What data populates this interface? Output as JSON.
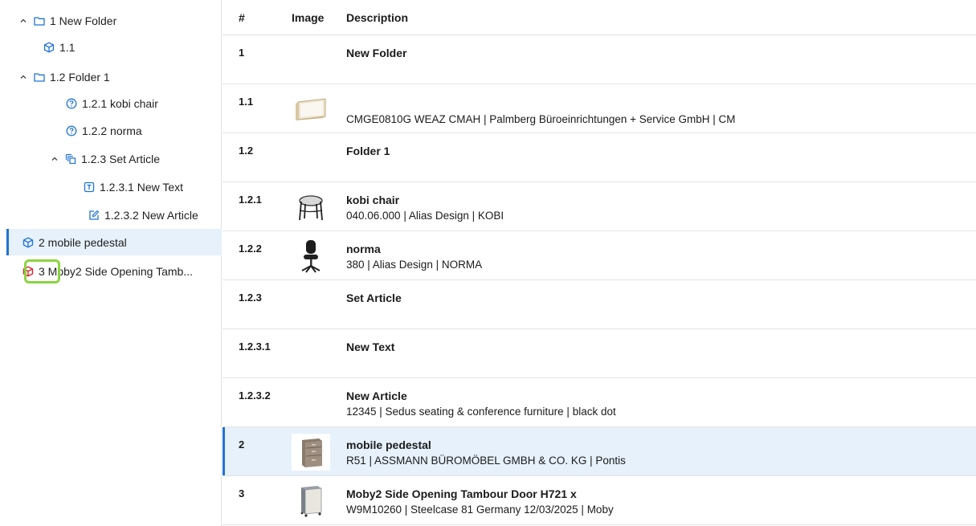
{
  "tree": {
    "items": [
      {
        "label": "1 New Folder",
        "icon": "folder-icon",
        "chevron": true,
        "indent": 0
      },
      {
        "label": "1.1",
        "icon": "box-icon",
        "chevron": false,
        "indent": 1
      },
      {
        "label": "1.2 Folder 1",
        "icon": "folder-icon",
        "chevron": true,
        "indent": 0
      },
      {
        "label": "1.2.1 kobi chair",
        "icon": "question-icon",
        "chevron": false,
        "indent": 2
      },
      {
        "label": "1.2.2 norma",
        "icon": "question-icon",
        "chevron": false,
        "indent": 2
      },
      {
        "label": "1.2.3 Set Article",
        "icon": "set-icon",
        "chevron": true,
        "indent": 1
      },
      {
        "label": "1.2.3.1 New Text",
        "icon": "text-icon",
        "chevron": false,
        "indent": 3
      },
      {
        "label": "1.2.3.2 New Article",
        "icon": "edit-icon",
        "chevron": false,
        "indent": 3
      },
      {
        "label": "2 mobile pedestal",
        "icon": "box-icon",
        "chevron": false,
        "indent": 0,
        "selected": true
      },
      {
        "label": "3 Moby2 Side Opening Tamb...",
        "icon": "box-red-icon",
        "chevron": false,
        "indent": 0
      }
    ]
  },
  "table": {
    "headers": {
      "num": "#",
      "image": "Image",
      "description": "Description"
    },
    "rows": [
      {
        "num": "1",
        "title": "New Folder",
        "subtitle": "",
        "image": ""
      },
      {
        "num": "1.1",
        "title": "",
        "subtitle": "CMGE0810G WEAZ  CMAH | Palmberg Büroeinrichtungen + Service GmbH | CM",
        "image": "shelf"
      },
      {
        "num": "1.2",
        "title": "Folder 1",
        "subtitle": "",
        "image": ""
      },
      {
        "num": "1.2.1",
        "title": "kobi chair",
        "subtitle": "040.06.000 | Alias Design | KOBI",
        "image": "chair"
      },
      {
        "num": "1.2.2",
        "title": "norma",
        "subtitle": "380 | Alias Design | NORMA",
        "image": "office-chair"
      },
      {
        "num": "1.2.3",
        "title": "Set Article",
        "subtitle": "",
        "image": ""
      },
      {
        "num": "1.2.3.1",
        "title": "New Text",
        "subtitle": "",
        "image": ""
      },
      {
        "num": "1.2.3.2",
        "title": "New Article",
        "subtitle": "12345 | Sedus seating & conference furniture | black dot",
        "image": ""
      },
      {
        "num": "2",
        "title": "mobile pedestal",
        "subtitle": "R51    | ASSMANN BÜROMÖBEL GMBH & CO. KG | Pontis",
        "image": "pedestal",
        "selected": true
      },
      {
        "num": "3",
        "title": "Moby2 Side Opening Tambour Door H721 x",
        "subtitle": "W9M10260 | Steelcase 81 Germany 12/03/2025 | Moby",
        "image": "cabinet"
      }
    ]
  },
  "colors": {
    "accent": "#1f73d6",
    "selected_bg": "#e6f1fb",
    "highlight": "#8bd43f",
    "icon_blue": "#1f73d6",
    "icon_red": "#d8262f"
  }
}
